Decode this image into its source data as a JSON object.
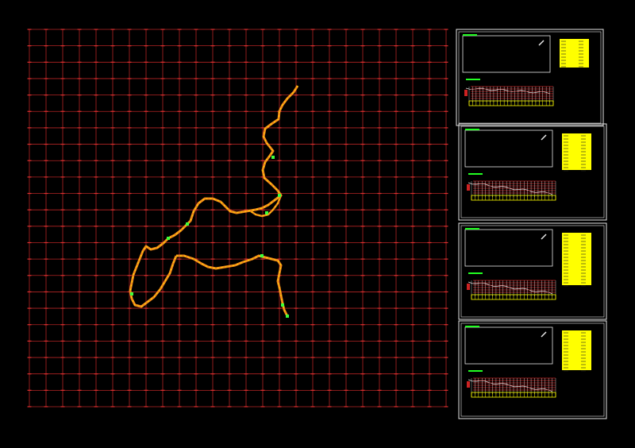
{
  "app": {
    "mode": "cad-drawing-canvas"
  },
  "colors": {
    "background": "#000000",
    "grid": "#b32424",
    "grid_tick": "#e03030",
    "route_main": "#f28a1a",
    "route_accent": "#ffe600",
    "route_marker": "#3cff3c",
    "frame": "#e6e6e6",
    "table_fill": "#ffff00",
    "profile_line": "#cc2222",
    "profile_green": "#22ff22"
  },
  "plan": {
    "grid_columns": 25,
    "grid_rows": 23,
    "route_segments": [
      "north-branch",
      "middle-branch",
      "south-branch"
    ]
  },
  "sheets": [
    {
      "id": "sheet-1",
      "detail_arrow": "north-east"
    },
    {
      "id": "sheet-2",
      "detail_arrow": "north-east"
    },
    {
      "id": "sheet-3",
      "detail_arrow": "north"
    },
    {
      "id": "sheet-4",
      "detail_arrow": "north-east"
    }
  ]
}
